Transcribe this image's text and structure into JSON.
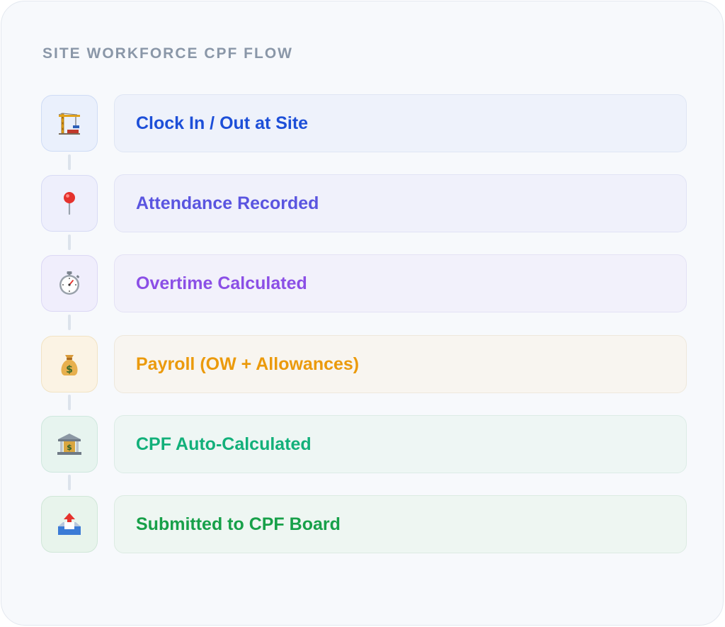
{
  "flow": {
    "title": "SITE WORKFORCE CPF FLOW",
    "steps": [
      {
        "label": "Clock In / Out at Site",
        "icon": "construction-crane-icon",
        "text_color": "#1d4fd8",
        "box_bg": "#eef2fb",
        "box_border": "#dfe6f4",
        "icon_bg": "#eaf0fc",
        "icon_border": "#cfdcf5"
      },
      {
        "label": "Attendance Recorded",
        "icon": "map-pin-icon",
        "text_color": "#5a55e0",
        "box_bg": "#f0f1fb",
        "box_border": "#e1e3f5",
        "icon_bg": "#eeeffc",
        "icon_border": "#d8dbf5"
      },
      {
        "label": "Overtime Calculated",
        "icon": "stopwatch-icon",
        "text_color": "#8b4fe6",
        "box_bg": "#f2f1fb",
        "box_border": "#e4e2f5",
        "icon_bg": "#f0eefc",
        "icon_border": "#dcd8f5"
      },
      {
        "label": "Payroll (OW + Allowances)",
        "icon": "money-bag-icon",
        "text_color": "#eb9a0c",
        "box_bg": "#f8f5f0",
        "box_border": "#eee8dc",
        "icon_bg": "#fbf3e4",
        "icon_border": "#f1e3c4"
      },
      {
        "label": "CPF Auto-Calculated",
        "icon": "bank-icon",
        "text_color": "#12b07a",
        "box_bg": "#eef6f4",
        "box_border": "#dcece6",
        "icon_bg": "#e7f4ef",
        "icon_border": "#cfe8de"
      },
      {
        "label": "Submitted to CPF Board",
        "icon": "outbox-tray-icon",
        "text_color": "#17a049",
        "box_bg": "#eef6f2",
        "box_border": "#dcebe2",
        "icon_bg": "#e8f4ec",
        "icon_border": "#d0e7d8"
      }
    ]
  }
}
